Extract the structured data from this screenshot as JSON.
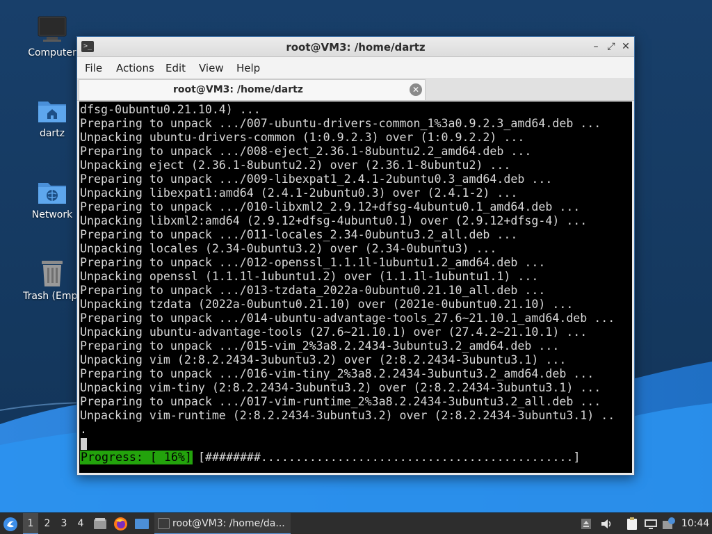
{
  "desktop": {
    "icons": [
      {
        "label": "Computer",
        "icon": "computer-icon"
      },
      {
        "label": "dartz",
        "icon": "home-folder-icon"
      },
      {
        "label": "Network",
        "icon": "network-folder-icon"
      },
      {
        "label": "Trash (Empt",
        "icon": "trash-icon"
      }
    ]
  },
  "window": {
    "title": "root@VM3: /home/dartz",
    "menu": [
      "File",
      "Actions",
      "Edit",
      "View",
      "Help"
    ],
    "tab": {
      "label": "root@VM3: /home/dartz"
    }
  },
  "terminal": {
    "lines": [
      "dfsg-0ubuntu0.21.10.4) ...",
      "Preparing to unpack .../007-ubuntu-drivers-common_1%3a0.9.2.3_amd64.deb ...",
      "Unpacking ubuntu-drivers-common (1:0.9.2.3) over (1:0.9.2.2) ...",
      "Preparing to unpack .../008-eject_2.36.1-8ubuntu2.2_amd64.deb ...",
      "Unpacking eject (2.36.1-8ubuntu2.2) over (2.36.1-8ubuntu2) ...",
      "Preparing to unpack .../009-libexpat1_2.4.1-2ubuntu0.3_amd64.deb ...",
      "Unpacking libexpat1:amd64 (2.4.1-2ubuntu0.3) over (2.4.1-2) ...",
      "Preparing to unpack .../010-libxml2_2.9.12+dfsg-4ubuntu0.1_amd64.deb ...",
      "Unpacking libxml2:amd64 (2.9.12+dfsg-4ubuntu0.1) over (2.9.12+dfsg-4) ...",
      "Preparing to unpack .../011-locales_2.34-0ubuntu3.2_all.deb ...",
      "Unpacking locales (2.34-0ubuntu3.2) over (2.34-0ubuntu3) ...",
      "Preparing to unpack .../012-openssl_1.1.1l-1ubuntu1.2_amd64.deb ...",
      "Unpacking openssl (1.1.1l-1ubuntu1.2) over (1.1.1l-1ubuntu1.1) ...",
      "Preparing to unpack .../013-tzdata_2022a-0ubuntu0.21.10_all.deb ...",
      "Unpacking tzdata (2022a-0ubuntu0.21.10) over (2021e-0ubuntu0.21.10) ...",
      "Preparing to unpack .../014-ubuntu-advantage-tools_27.6~21.10.1_amd64.deb ...",
      "Unpacking ubuntu-advantage-tools (27.6~21.10.1) over (27.4.2~21.10.1) ...",
      "Preparing to unpack .../015-vim_2%3a8.2.2434-3ubuntu3.2_amd64.deb ...",
      "Unpacking vim (2:8.2.2434-3ubuntu3.2) over (2:8.2.2434-3ubuntu3.1) ...",
      "Preparing to unpack .../016-vim-tiny_2%3a8.2.2434-3ubuntu3.2_amd64.deb ...",
      "Unpacking vim-tiny (2:8.2.2434-3ubuntu3.2) over (2:8.2.2434-3ubuntu3.1) ...",
      "Preparing to unpack .../017-vim-runtime_2%3a8.2.2434-3ubuntu3.2_all.deb ...",
      "Unpacking vim-runtime (2:8.2.2434-3ubuntu3.2) over (2:8.2.2434-3ubuntu3.1) ..",
      "."
    ],
    "progress_label": "Progress: [ 16%]",
    "progress_bar": "[########.............................................]",
    "progress_percent": 16
  },
  "taskbar": {
    "workspaces": [
      "1",
      "2",
      "3",
      "4"
    ],
    "active_workspace": "1",
    "task_label": "root@VM3: /home/da...",
    "clock": "10:44"
  },
  "colors": {
    "progress_green": "#23a30c",
    "terminal_bg": "#000000",
    "taskbar_bg": "#2d2d2d",
    "accent": "#5d9ae0"
  }
}
